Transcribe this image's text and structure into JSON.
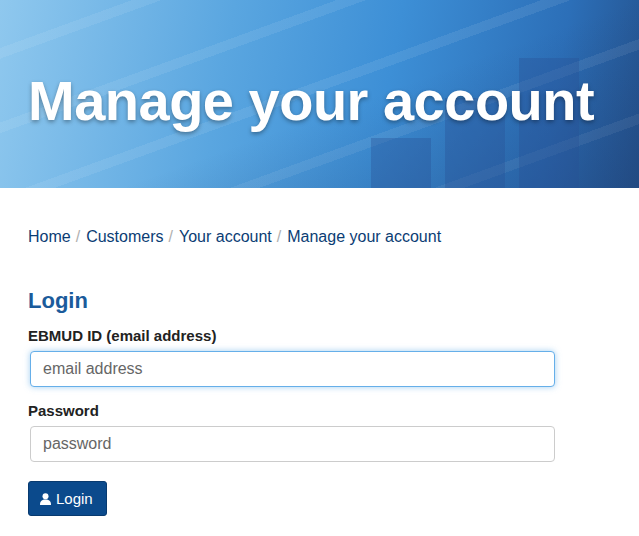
{
  "header": {
    "title": "Manage your account"
  },
  "breadcrumb": {
    "separator": "/",
    "items": [
      {
        "label": "Home"
      },
      {
        "label": "Customers"
      },
      {
        "label": "Your account"
      },
      {
        "label": "Manage your account"
      }
    ]
  },
  "login": {
    "title": "Login",
    "fields": [
      {
        "label": "EBMUD ID (email address)",
        "placeholder": "email address",
        "focused": true
      },
      {
        "label": "Password",
        "placeholder": "password",
        "focused": false
      }
    ],
    "button": {
      "label": "Login"
    }
  }
}
